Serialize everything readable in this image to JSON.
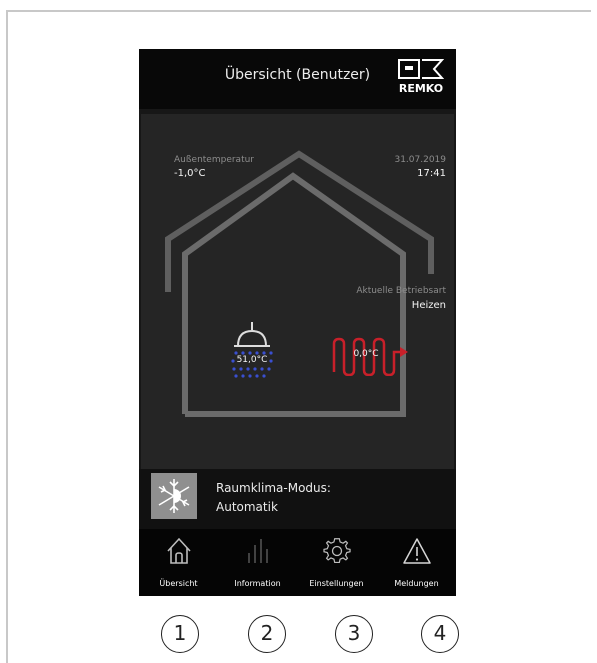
{
  "header": {
    "title": "Übersicht (Benutzer)",
    "logo_text": "REMKO"
  },
  "overview": {
    "outdoor_label": "Außentemperatur",
    "outdoor_value": "-1,0°C",
    "date": "31.07.2019",
    "time": "17:41",
    "mode_label": "Aktuelle Betriebsart",
    "mode_value": "Heizen",
    "hot_water_temp": "51,0°C",
    "heating_temp": "0,0°C"
  },
  "climate_mode": {
    "label": "Raumklima-Modus:",
    "value": "Automatik",
    "icon": "snowflake-sun-icon"
  },
  "nav": {
    "items": [
      {
        "label": "Übersicht",
        "icon": "home-icon"
      },
      {
        "label": "Information",
        "icon": "bar-chart-icon"
      },
      {
        "label": "Einstellungen",
        "icon": "gear-icon"
      },
      {
        "label": "Meldungen",
        "icon": "warning-icon"
      }
    ]
  },
  "callouts": [
    "1",
    "2",
    "3",
    "4"
  ],
  "colors": {
    "heating_red": "#c8202a",
    "water_blue": "#3a4fd0",
    "house_gray": "#6b6b6b"
  }
}
